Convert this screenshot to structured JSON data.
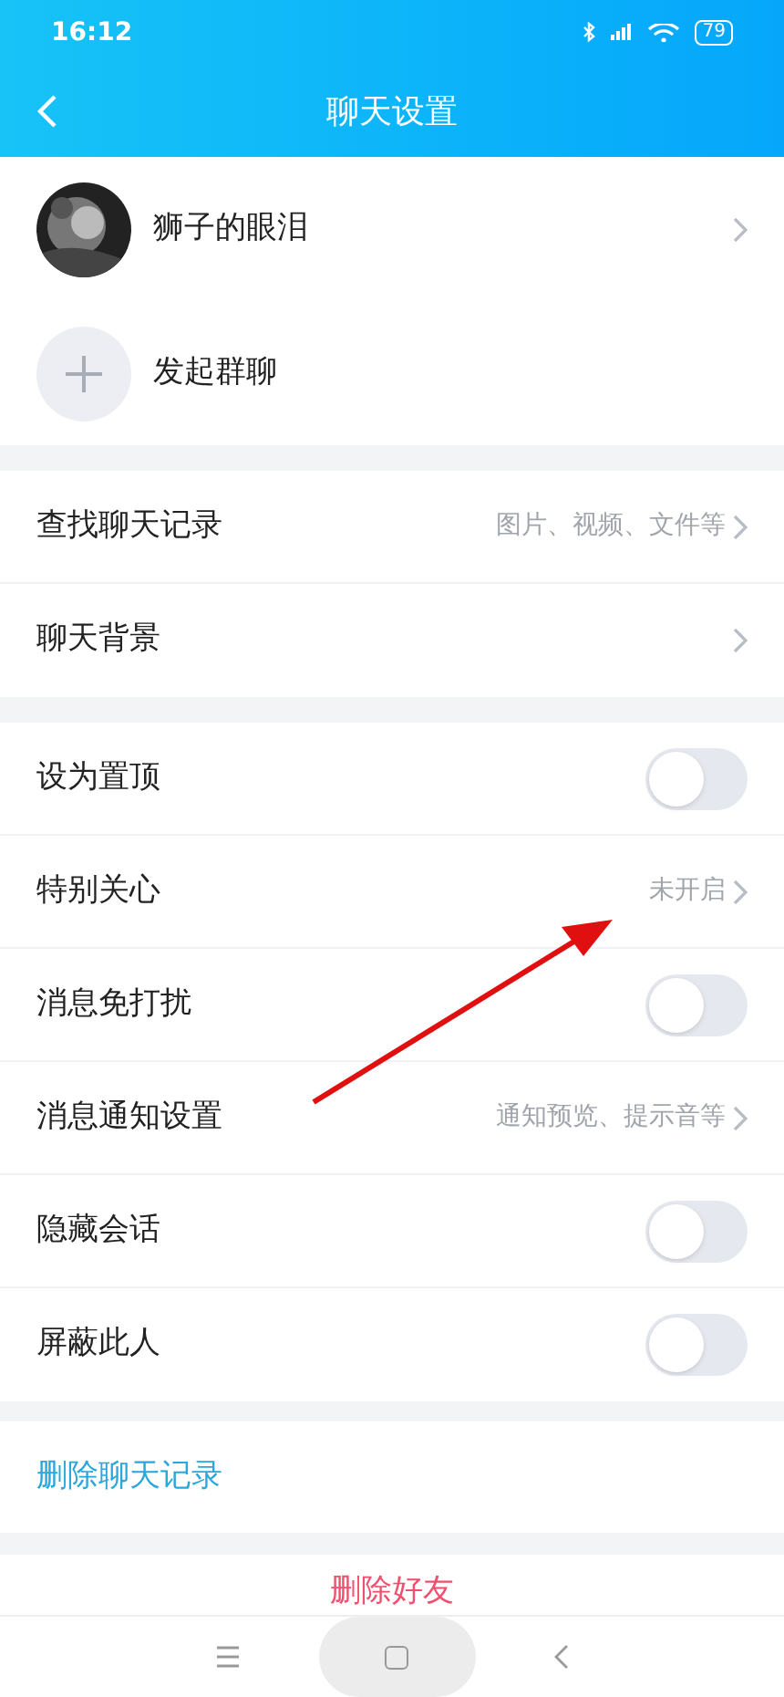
{
  "status_bar": {
    "time": "16:12",
    "battery": "79"
  },
  "header": {
    "title": "聊天设置"
  },
  "contact": {
    "name": "狮子的眼泪"
  },
  "group_chat": {
    "label": "发起群聊"
  },
  "sections": [
    [
      {
        "kind": "link",
        "label": "查找聊天记录",
        "value": "图片、视频、文件等"
      },
      {
        "kind": "link",
        "label": "聊天背景"
      }
    ],
    [
      {
        "kind": "toggle",
        "label": "设为置顶",
        "on": false
      },
      {
        "kind": "link",
        "label": "特别关心",
        "value": "未开启"
      },
      {
        "kind": "toggle",
        "label": "消息免打扰",
        "on": false
      },
      {
        "kind": "link",
        "label": "消息通知设置",
        "value": "通知预览、提示音等"
      },
      {
        "kind": "toggle",
        "label": "隐藏会话",
        "on": false
      },
      {
        "kind": "toggle",
        "label": "屏蔽此人",
        "on": false
      }
    ]
  ],
  "delete_history": "删除聊天记录",
  "delete_friend": "删除好友"
}
